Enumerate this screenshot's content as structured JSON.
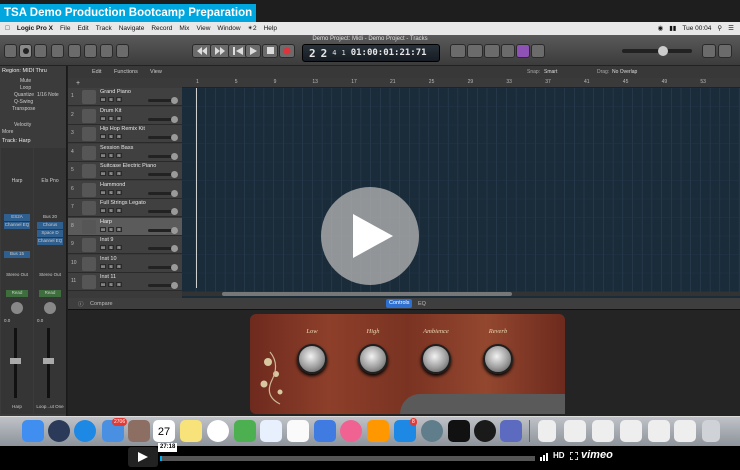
{
  "video_title": "TSA Demo Production Bootcamp Preparation",
  "menubar": {
    "app": "Logic Pro X",
    "items": [
      "File",
      "Edit",
      "Track",
      "Navigate",
      "Record",
      "Mix",
      "View",
      "Window",
      "✴2",
      "Help"
    ],
    "clock": "Tue 00:04"
  },
  "window_title": "Demo Project: Midi - Demo Project - Tracks",
  "lcd": {
    "bar": "2",
    "beat": "2",
    "div": "4",
    "tick": "1",
    "time": "01:00:01:21:71"
  },
  "inspector": {
    "region_header": "Region: MIDI Thru",
    "rows": [
      "Mute",
      "Loop",
      "Quantize",
      "Q-Swing",
      "Transpose",
      "Velocity"
    ],
    "quantize_value": "1/16 Note",
    "more": "More",
    "track_header": "Track: Harp",
    "strip_a": {
      "name": "Harp",
      "plugin": "ES2A",
      "eq": "Channel EQ",
      "bus": "Bus 15",
      "out": "Stereo Out",
      "mode": "Read",
      "vol": "0.0",
      "label": "Harp"
    },
    "strip_b": {
      "name": "Els Pno",
      "plugin": "Chorus",
      "sends": [
        "Space D",
        "Channel EQ"
      ],
      "bus": "Bus 20",
      "out": "Stereo Out",
      "mode": "Read",
      "vol": "0.0",
      "label": "Loop...ut One"
    }
  },
  "editor_menu": [
    "Edit",
    "Functions",
    "View"
  ],
  "snap": {
    "label": "Snap:",
    "value": "Smart",
    "drag_label": "Drag:",
    "drag_value": "No Overlap"
  },
  "ruler_marks": [
    "1",
    "5",
    "9",
    "13",
    "17",
    "21",
    "25",
    "29",
    "33",
    "37",
    "41",
    "45",
    "49",
    "53"
  ],
  "tracks": [
    {
      "num": "1",
      "name": "Grand Piano"
    },
    {
      "num": "2",
      "name": "Drum Kit"
    },
    {
      "num": "3",
      "name": "Hip Hop Remix Kit"
    },
    {
      "num": "4",
      "name": "Session Bass"
    },
    {
      "num": "5",
      "name": "Suitcase Electric Piano"
    },
    {
      "num": "6",
      "name": "Hammond"
    },
    {
      "num": "7",
      "name": "Full Strings Legato"
    },
    {
      "num": "8",
      "name": "Harp"
    },
    {
      "num": "9",
      "name": "Inst 9"
    },
    {
      "num": "10",
      "name": "Inst 10"
    },
    {
      "num": "11",
      "name": "Inst 11"
    }
  ],
  "smart_controls": {
    "compare": "Compare",
    "tabs": [
      "Controls",
      "EQ"
    ],
    "knobs": [
      "Low",
      "High",
      "Ambience",
      "Reverb"
    ]
  },
  "dock": {
    "badges": {
      "mail": "2706",
      "calendar": "27",
      "appstore": "8"
    }
  },
  "player": {
    "time": "27:18",
    "hd": "HD",
    "brand": "vimeo"
  },
  "colors": {
    "accent": "#00a6de",
    "progress": "#00adef"
  }
}
